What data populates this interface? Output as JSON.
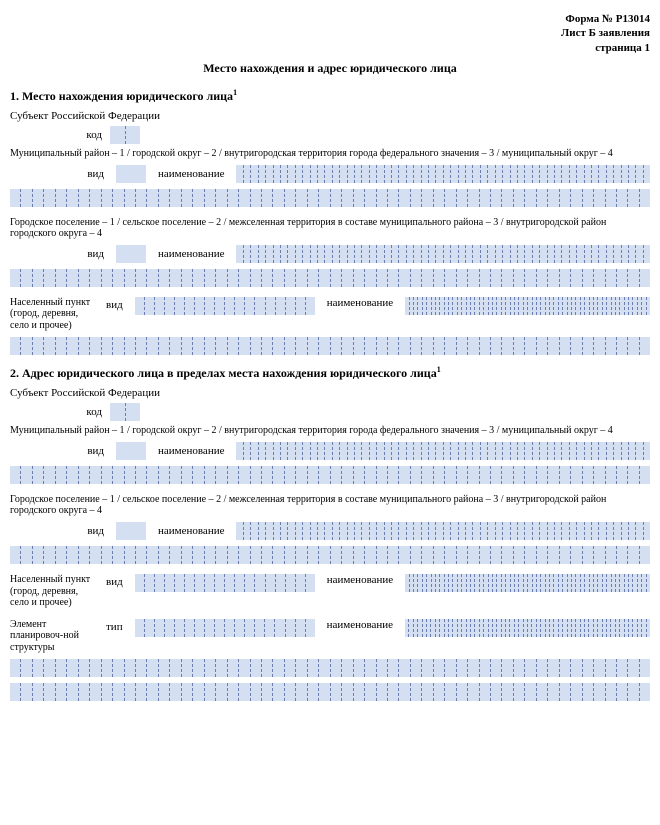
{
  "header": {
    "form_no": "Форма № Р13014",
    "sheet": "Лист Б заявления",
    "page": "страница 1"
  },
  "title": "Место нахождения и адрес юридического лица",
  "section1": {
    "heading": "1. Место нахождения юридического лица",
    "subject_rf": "Субъект Российской Федерации",
    "kod": "код",
    "mun_types": "Муниципальный район – 1 / городской округ – 2 / внутригородская территория города федерального значения – 3 / муниципальный округ – 4",
    "vid": "вид",
    "naimen": "наименование",
    "settlement_types": "Городское поселение – 1 / сельское поселение – 2 / межселенная территория в составе муниципального района – 3 / внутригородской район городского округа – 4",
    "nas_punkt": "Населенный пункт (город, деревня, село и прочее)"
  },
  "section2": {
    "heading": "2. Адрес юридического лица в пределах места нахождения юридического лица",
    "plan_struct": "Элемент планировоч-ной структуры",
    "tip": "тип"
  }
}
